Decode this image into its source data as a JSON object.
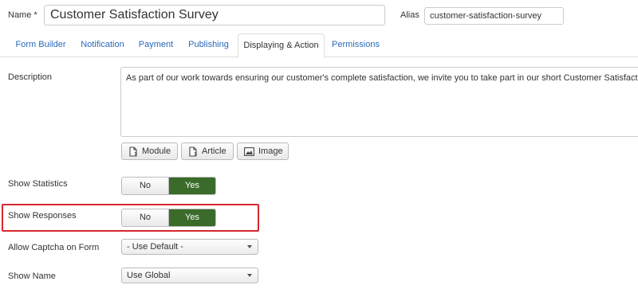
{
  "form": {
    "name_label": "Name *",
    "name_value": "Customer Satisfaction Survey",
    "alias_label": "Alias",
    "alias_value": "customer-satisfaction-survey"
  },
  "tabs": [
    {
      "label": "Form Builder"
    },
    {
      "label": "Notification"
    },
    {
      "label": "Payment"
    },
    {
      "label": "Publishing"
    },
    {
      "label": "Displaying & Action",
      "active": true
    },
    {
      "label": "Permissions"
    }
  ],
  "description": {
    "label": "Description",
    "text": "As part of our work towards ensuring our customer's complete satisfaction, we invite you to take part in our short Customer Satisfaction Survey"
  },
  "editor_buttons": [
    {
      "label": "Module",
      "icon": "insert-module-icon"
    },
    {
      "label": "Article",
      "icon": "insert-article-icon"
    },
    {
      "label": "Image",
      "icon": "picture-icon"
    }
  ],
  "show_statistics": {
    "label": "Show Statistics",
    "no": "No",
    "yes": "Yes",
    "value": "Yes"
  },
  "show_responses": {
    "label": "Show Responses",
    "no": "No",
    "yes": "Yes",
    "value": "Yes",
    "highlight_color": "#d4282d"
  },
  "allow_captcha": {
    "label": "Allow Captcha on Form",
    "value": "- Use Default -"
  },
  "show_name": {
    "label": "Show Name",
    "value": "Use Global"
  },
  "colors": {
    "link": "#2a69b8",
    "toggle_active": "#3a6b2a"
  }
}
